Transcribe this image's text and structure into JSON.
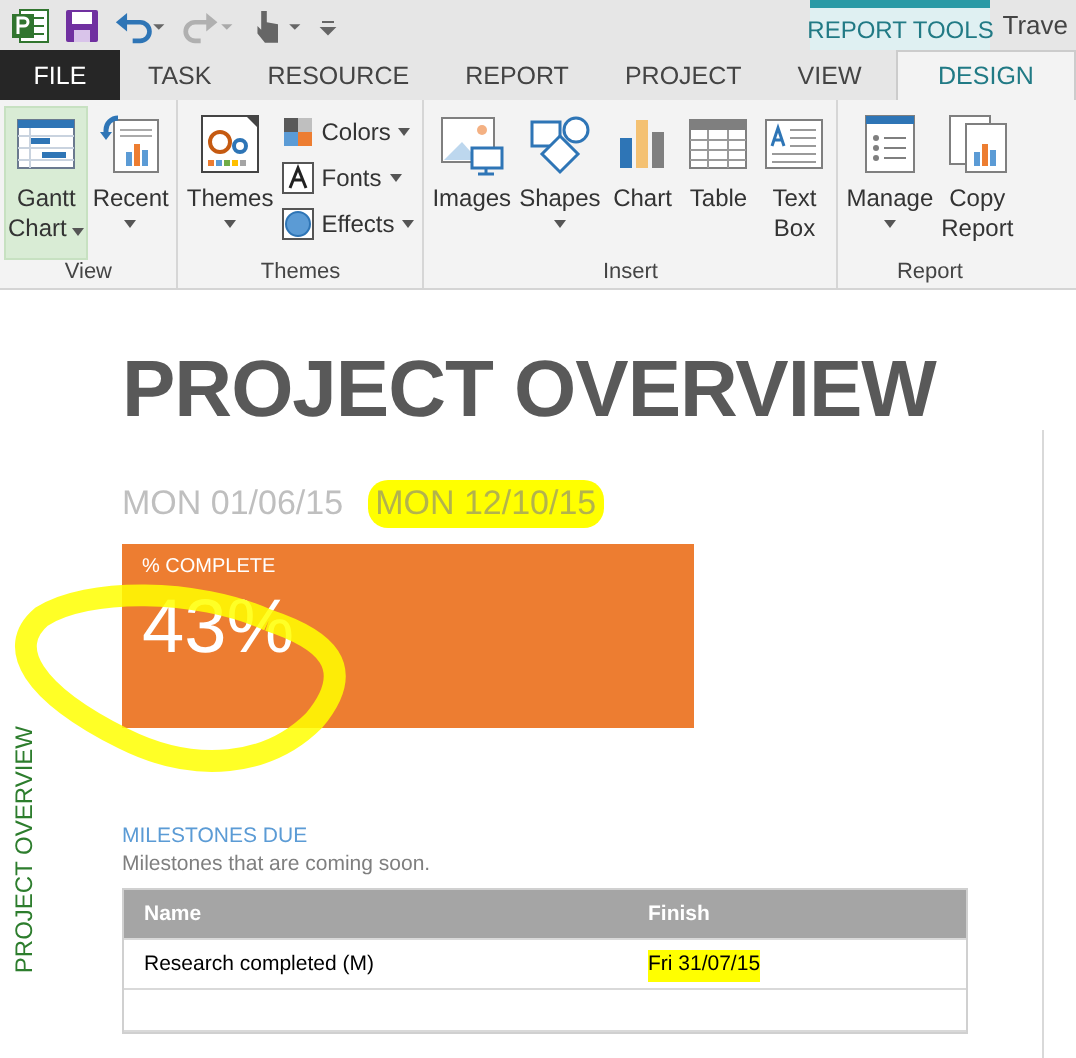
{
  "window": {
    "title": "Trave",
    "contextual_label": "REPORT TOOLS"
  },
  "tabs": [
    {
      "label": "FILE",
      "kind": "file",
      "selected": false
    },
    {
      "label": "TASK",
      "kind": "tab",
      "selected": false
    },
    {
      "label": "RESOURCE",
      "kind": "tab",
      "selected": false
    },
    {
      "label": "REPORT",
      "kind": "tab",
      "selected": false
    },
    {
      "label": "PROJECT",
      "kind": "tab",
      "selected": false
    },
    {
      "label": "VIEW",
      "kind": "tab",
      "selected": false
    },
    {
      "label": "DESIGN",
      "kind": "tab",
      "selected": true
    }
  ],
  "ribbon": [
    {
      "label": "View",
      "buttons": [
        {
          "lines": [
            "Gantt",
            "Chart"
          ],
          "dropdown": true,
          "selected": true,
          "kind": "large"
        },
        {
          "lines": [
            "Recent"
          ],
          "dropdown": true,
          "selected": false,
          "kind": "large"
        }
      ]
    },
    {
      "label": "Themes",
      "buttons": [
        {
          "lines": [
            "Themes"
          ],
          "dropdown": true,
          "selected": false,
          "kind": "large"
        },
        {
          "lines": [
            "Colors"
          ],
          "dropdown": true,
          "kind": "small"
        },
        {
          "lines": [
            "Fonts"
          ],
          "dropdown": true,
          "kind": "small"
        },
        {
          "lines": [
            "Effects"
          ],
          "dropdown": true,
          "kind": "small"
        }
      ]
    },
    {
      "label": "Insert",
      "buttons": [
        {
          "lines": [
            "Images"
          ],
          "dropdown": false,
          "selected": false,
          "kind": "large"
        },
        {
          "lines": [
            "Shapes"
          ],
          "dropdown": true,
          "selected": false,
          "kind": "large"
        },
        {
          "lines": [
            "Chart"
          ],
          "dropdown": false,
          "selected": false,
          "kind": "large"
        },
        {
          "lines": [
            "Table"
          ],
          "dropdown": false,
          "selected": false,
          "kind": "large"
        },
        {
          "lines": [
            "Text",
            "Box"
          ],
          "dropdown": false,
          "selected": false,
          "kind": "large"
        }
      ]
    },
    {
      "label": "Report",
      "buttons": [
        {
          "lines": [
            "Manage"
          ],
          "dropdown": true,
          "selected": false,
          "kind": "large"
        },
        {
          "lines": [
            "Copy",
            "Report"
          ],
          "dropdown": false,
          "selected": false,
          "kind": "large"
        }
      ]
    }
  ],
  "report": {
    "side_label": "PROJECT OVERVIEW",
    "title": "PROJECT OVERVIEW",
    "dates": [
      {
        "text": "MON 01/06/15",
        "highlighted": false
      },
      {
        "text": "MON 12/10/15",
        "highlighted": true
      }
    ],
    "complete": {
      "label": "% COMPLETE",
      "value": "43%",
      "circled": true
    },
    "milestones": {
      "heading": "MILESTONES DUE",
      "subtitle": "Milestones that are coming soon.",
      "columns": [
        "Name",
        "Finish"
      ],
      "rows": [
        {
          "name": "Research completed (M)",
          "finish": "Fri 31/07/15",
          "highlighted": true
        }
      ]
    }
  }
}
